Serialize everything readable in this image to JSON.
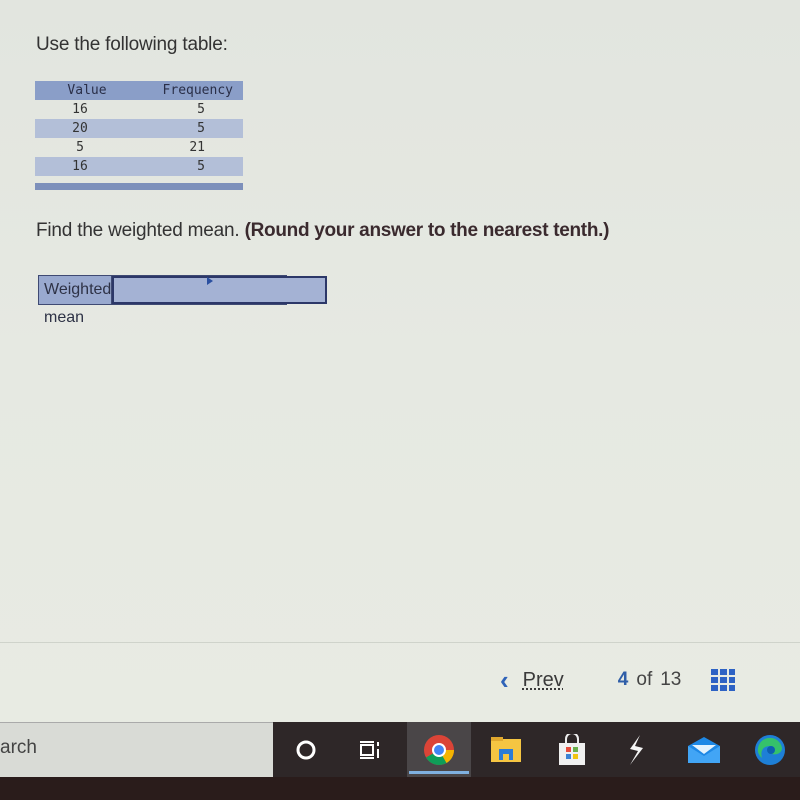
{
  "question": {
    "instruction": "Use the following table:",
    "table": {
      "headers": [
        "Value",
        "Frequency"
      ],
      "rows": [
        {
          "value": "16",
          "frequency": "5"
        },
        {
          "value": "20",
          "frequency": "5"
        },
        {
          "value": "5",
          "frequency": "21"
        },
        {
          "value": "16",
          "frequency": "5"
        }
      ]
    },
    "prompt": "Find the weighted mean.",
    "prompt_bold": "(Round your answer to the nearest tenth.)",
    "answer": {
      "label": "Weighted mean",
      "value": ""
    }
  },
  "navigation": {
    "prev_label": "Prev",
    "current_page": "4",
    "of_label": "of",
    "total_pages": "13"
  },
  "taskbar": {
    "search_text": "arch",
    "icons": [
      {
        "name": "cortana-icon"
      },
      {
        "name": "task-view-icon"
      },
      {
        "name": "chrome-icon",
        "active": true
      },
      {
        "name": "file-explorer-icon"
      },
      {
        "name": "microsoft-store-icon"
      },
      {
        "name": "lightning-app-icon"
      },
      {
        "name": "mail-icon"
      },
      {
        "name": "edge-icon"
      }
    ]
  },
  "colors": {
    "accent_blue": "#2f5ea8",
    "table_header": "#8a9ec8",
    "table_alt_row": "#b3bfd8"
  }
}
